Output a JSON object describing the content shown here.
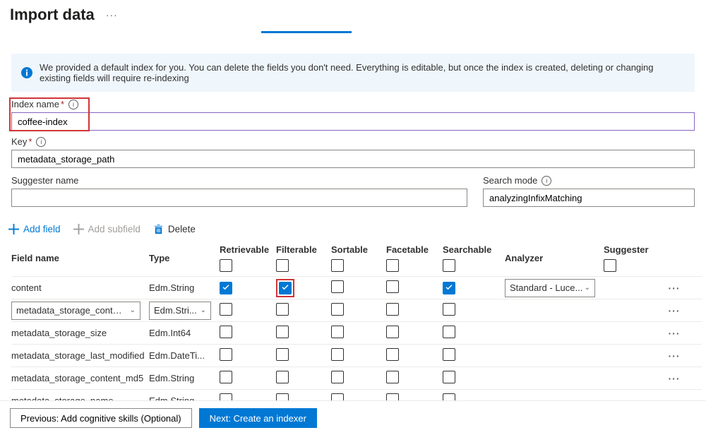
{
  "header": {
    "title": "Import data"
  },
  "info": {
    "text": "We provided a default index for you. You can delete the fields you don't need. Everything is editable, but once the index is created, deleting or changing existing fields will require re-indexing"
  },
  "form": {
    "index_name_label": "Index name",
    "index_name_value": "coffee-index",
    "key_label": "Key",
    "key_value": "metadata_storage_path",
    "suggester_label": "Suggester name",
    "suggester_value": "",
    "search_mode_label": "Search mode",
    "search_mode_value": "analyzingInfixMatching"
  },
  "toolbar": {
    "add_field": "Add field",
    "add_subfield": "Add subfield",
    "delete": "Delete"
  },
  "columns": {
    "field_name": "Field name",
    "type": "Type",
    "retrievable": "Retrievable",
    "filterable": "Filterable",
    "sortable": "Sortable",
    "facetable": "Facetable",
    "searchable": "Searchable",
    "analyzer": "Analyzer",
    "suggester": "Suggester"
  },
  "rows": [
    {
      "name": "content",
      "type": "Edm.String",
      "retrievable": true,
      "filterable": true,
      "filterable_highlight": true,
      "sortable": false,
      "facetable": false,
      "searchable": true,
      "analyzer": "Standard - Luce...",
      "type_as_dropdown": false
    },
    {
      "name": "metadata_storage_content_ty...",
      "type": "Edm.Stri...",
      "retrievable": false,
      "filterable": false,
      "sortable": false,
      "facetable": false,
      "searchable": false,
      "analyzer": "",
      "type_as_dropdown": true,
      "name_as_dropdown": true
    },
    {
      "name": "metadata_storage_size",
      "type": "Edm.Int64",
      "retrievable": false,
      "filterable": false,
      "sortable": false,
      "facetable": false,
      "searchable": false,
      "analyzer": "",
      "type_as_dropdown": false
    },
    {
      "name": "metadata_storage_last_modified",
      "type": "Edm.DateTi...",
      "retrievable": false,
      "filterable": false,
      "sortable": false,
      "facetable": false,
      "searchable": false,
      "analyzer": "",
      "type_as_dropdown": false
    },
    {
      "name": "metadata_storage_content_md5",
      "type": "Edm.String",
      "retrievable": false,
      "filterable": false,
      "sortable": false,
      "facetable": false,
      "searchable": false,
      "analyzer": "",
      "type_as_dropdown": false
    },
    {
      "name": "metadata_storage_name",
      "type": "Edm.String",
      "retrievable": false,
      "filterable": false,
      "sortable": false,
      "facetable": false,
      "searchable": false,
      "analyzer": "",
      "type_as_dropdown": false
    }
  ],
  "footer": {
    "prev": "Previous: Add cognitive skills (Optional)",
    "next": "Next: Create an indexer"
  }
}
